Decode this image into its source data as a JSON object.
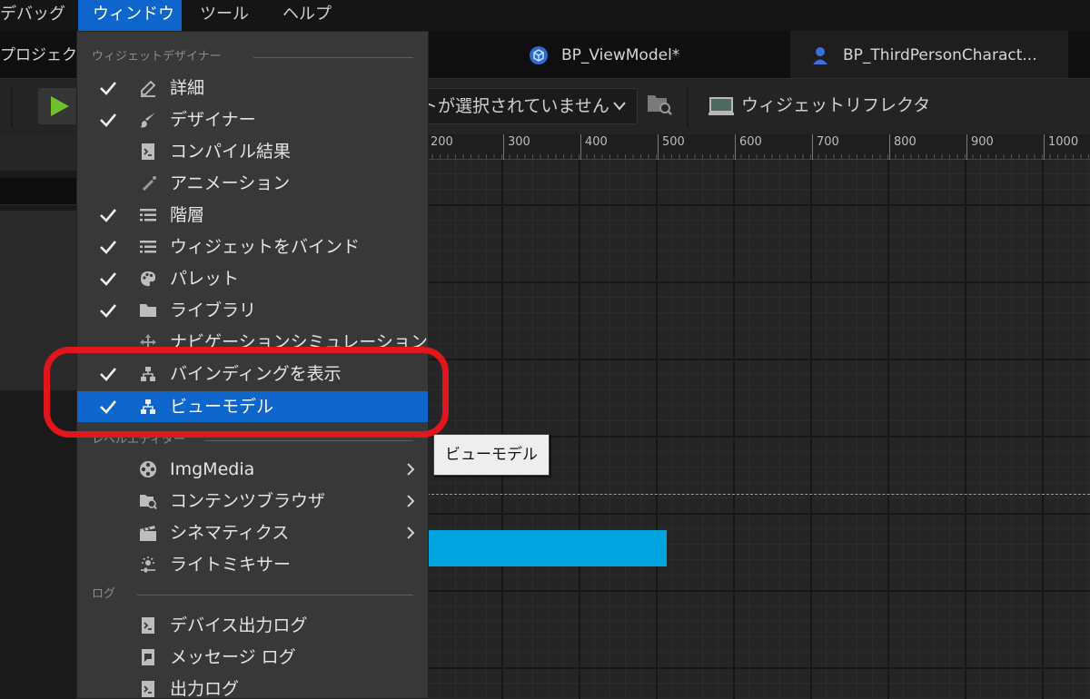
{
  "menubar": {
    "items": [
      "デバッグ",
      "ウィンドウ",
      "ツール",
      "ヘルプ"
    ]
  },
  "tabs": {
    "project": "プロジェク",
    "view_model": "BP_ViewModel*",
    "third_person": "BP_ThirdPersonCharact..."
  },
  "toolbar": {
    "viewmodel_select": "トが選択されていません",
    "widget_reflector": "ウィジェットリフレクタ"
  },
  "ruler": {
    "ticks": [
      "200",
      "300",
      "400",
      "500",
      "600",
      "700",
      "800",
      "900",
      "1000"
    ]
  },
  "dropdown": {
    "section_widget_designer": "ウィジェットデザイナー",
    "section_level_editor": "レベルエディター",
    "section_log": "ログ",
    "items": [
      {
        "label": "詳細",
        "checked": true,
        "icon": "edit-icon"
      },
      {
        "label": "デザイナー",
        "checked": true,
        "icon": "brush-icon"
      },
      {
        "label": "コンパイル結果",
        "checked": false,
        "icon": "console-icon"
      },
      {
        "label": "アニメーション",
        "checked": false,
        "icon": "animation-icon"
      },
      {
        "label": "階層",
        "checked": true,
        "icon": "list-icon"
      },
      {
        "label": "ウィジェットをバインド",
        "checked": true,
        "icon": "list-icon"
      },
      {
        "label": "パレット",
        "checked": true,
        "icon": "palette-icon"
      },
      {
        "label": "ライブラリ",
        "checked": true,
        "icon": "folder-icon"
      },
      {
        "label": "ナビゲーションシミュレーション",
        "checked": false,
        "icon": "navigation-icon"
      },
      {
        "label": "バインディングを表示",
        "checked": true,
        "icon": "hierarchy-icon"
      },
      {
        "label": "ビューモデル",
        "checked": true,
        "icon": "hierarchy-icon"
      },
      {
        "label": "ImgMedia",
        "checked": false,
        "icon": "film-reel-icon",
        "submenu": true
      },
      {
        "label": "コンテンツブラウザ",
        "checked": false,
        "icon": "folder-search-icon",
        "submenu": true
      },
      {
        "label": "シネマティクス",
        "checked": false,
        "icon": "clapper-icon",
        "submenu": true
      },
      {
        "label": "ライトミキサー",
        "checked": false,
        "icon": "light-mixer-icon"
      },
      {
        "label": "デバイス出力ログ",
        "checked": false,
        "icon": "console-icon"
      },
      {
        "label": "メッセージ ログ",
        "checked": false,
        "icon": "message-log-icon"
      },
      {
        "label": "出力ログ",
        "checked": false,
        "icon": "console-icon"
      }
    ]
  },
  "tooltip": {
    "text": "ビューモデル"
  },
  "colors": {
    "accent": "#0e66cc",
    "highlight_ring": "#e0161c",
    "canvas_bar": "#00a5e0"
  }
}
